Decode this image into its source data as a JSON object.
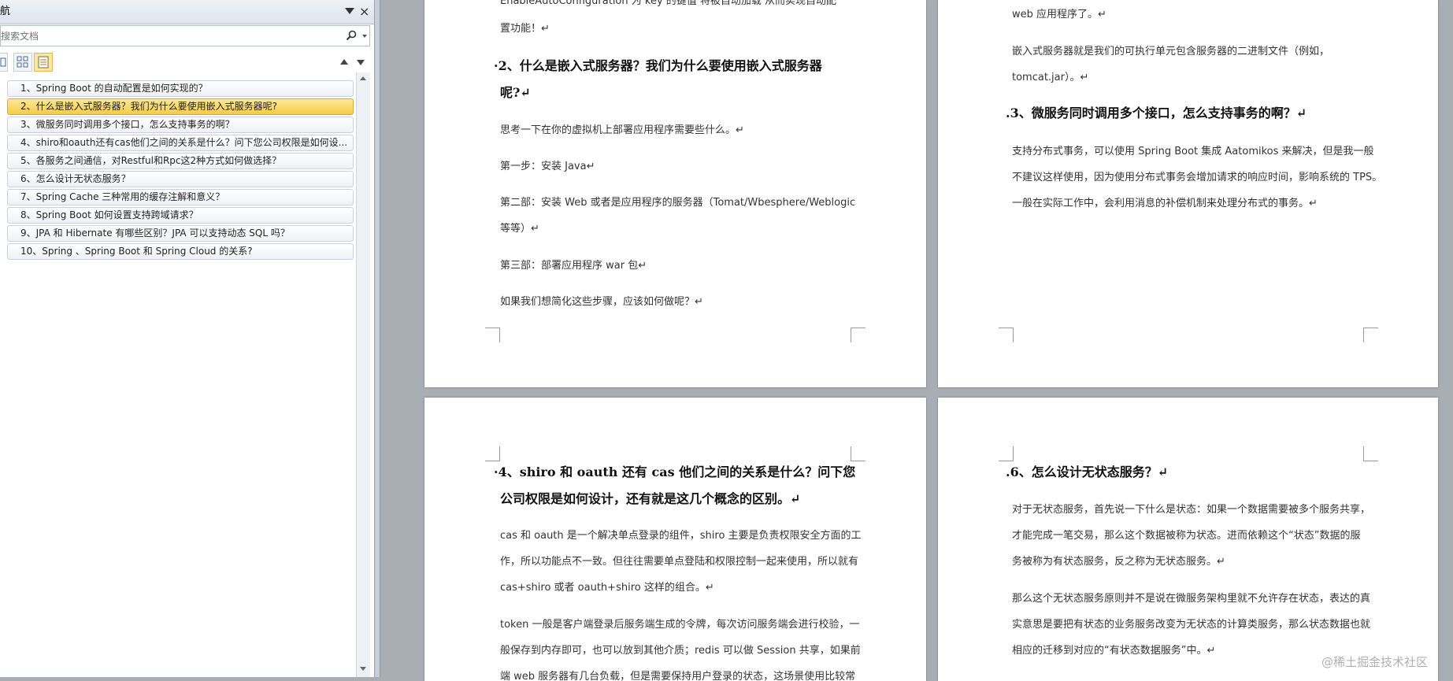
{
  "nav": {
    "title": "航",
    "close_glyph": "×",
    "search_placeholder": "搜索文档",
    "headings": [
      "1、Spring Boot 的自动配置是如何实现的？",
      "2、什么是嵌入式服务器？我们为什么要使用嵌入式服务器呢?",
      "3、微服务同时调用多个接口，怎么支持事务的啊？",
      "4、shiro和oauth还有cas他们之间的关系是什么？问下您公司权限是如何设...",
      "5、各服务之间通信，对Restful和Rpc这2种方式如何做选择？",
      "6、怎么设计无状态服务？",
      "7、Spring Cache 三种常用的缓存注解和意义？",
      "8、Spring Boot 如何设置支持跨域请求？",
      "9、JPA 和 Hibernate 有哪些区别？JPA 可以支持动态 SQL 吗？",
      "10、Spring 、Spring Boot 和 Spring Cloud 的关系?"
    ]
  },
  "page1": {
    "line_top": "EnableAutoConfiguration 为 key 的键值 将被自动加载 从而实现自动配",
    "line_end": "置功能！↵",
    "heading_l1": "·2、什么是嵌入式服务器？我们为什么要使用嵌入式服务器",
    "heading_l2": "呢?↵",
    "p1": "思考一下在你的虚拟机上部署应用程序需要些什么。↵",
    "p2": "第一步：安装 Java↵",
    "p3_l1": "第二部：安装 Web 或者是应用程序的服务器（Tomat/Wbesphere/Weblogic",
    "p3_l2": "等等）↵",
    "p4": "第三部：部署应用程序 war 包↵",
    "p5": "如果我们想简化这些步骤，应该如何做呢？↵"
  },
  "page2": {
    "line_top": "web 应用程序了。↵",
    "p1_l1": "嵌入式服务器就是我们的可执行单元包含服务器的二进制文件（例如，",
    "p1_l2": "tomcat.jar）。↵",
    "heading": ".3、微服务同时调用多个接口，怎么支持事务的啊？↵",
    "p2_l1": "支持分布式事务，可以使用 Spring Boot 集成 Aatomikos 来解决，但是我一般",
    "p2_l2": "不建议这样使用，因为使用分布式事务会增加请求的响应时间，影响系统的 TPS。",
    "p2_l3": "一般在实际工作中，会利用消息的补偿机制来处理分布式的事务。↵"
  },
  "page3": {
    "heading_l1": "·4、shiro 和 oauth 还有 cas 他们之间的关系是什么？问下您",
    "heading_l2": "公司权限是如何设计，还有就是这几个概念的区别。↵",
    "p1_l1": "cas 和 oauth 是一个解决单点登录的组件，shiro 主要是负责权限安全方面的工",
    "p1_l2": "作，所以功能点不一致。但往往需要单点登陆和权限控制一起来使用，所以就有",
    "p1_l3": "cas+shiro 或者 oauth+shiro 这样的组合。↵",
    "p2_l1": "token 一般是客户端登录后服务端生成的令牌，每次访问服务端会进行校验，一",
    "p2_l2": "般保存到内存即可，也可以放到其他介质；redis 可以做 Session 共享，如果前",
    "p2_l3": "端 web 服务器有几台负载，但是需要保持用户登录的状态，这场景使用比较常"
  },
  "page4": {
    "heading": ".6、怎么设计无状态服务？↵",
    "p1_l1": "对于无状态服务，首先说一下什么是状态：如果一个数据需要被多个服务共享，",
    "p1_l2": "才能完成一笔交易，那么这个数据被称为状态。进而依赖这个“状态”数据的服",
    "p1_l3": "务被称为有状态服务，反之称为无状态服务。↵",
    "p2_l1": "那么这个无状态服务原则并不是说在微服务架构里就不允许存在状态，表达的真",
    "p2_l2": "实意思是要把有状态的业务服务改变为无状态的计算类服务，那么状态数据也就",
    "p2_l3": "相应的迁移到对应的“有状态数据服务”中。↵"
  },
  "watermark": "@稀土掘金技术社区",
  "colors": {
    "selected_heading": "#f6cc45",
    "app_background": "#a9aeb5"
  }
}
